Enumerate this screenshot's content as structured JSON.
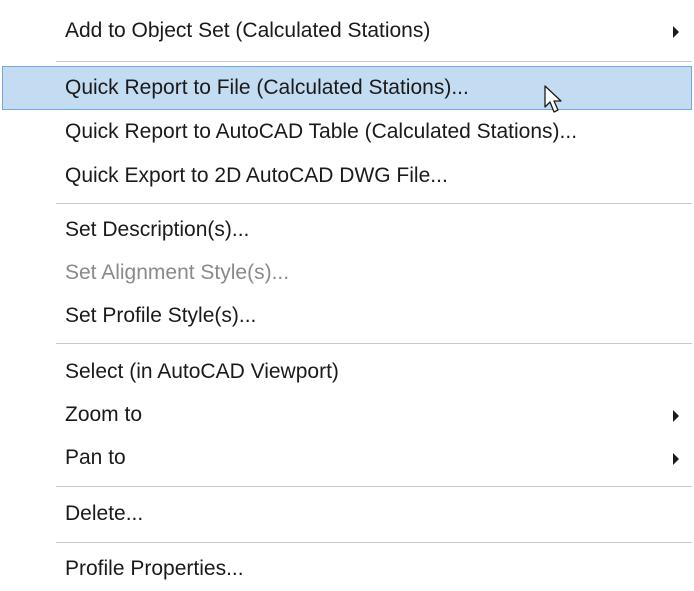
{
  "context_menu": {
    "items": [
      {
        "label": "Add to Object Set (Calculated Stations)",
        "submenu": true,
        "state": "normal"
      },
      {
        "label": "Quick Report to File (Calculated Stations)...",
        "submenu": false,
        "state": "highlighted"
      },
      {
        "label": "Quick Report to AutoCAD Table (Calculated Stations)...",
        "submenu": false,
        "state": "normal"
      },
      {
        "label": "Quick Export to 2D AutoCAD DWG File...",
        "submenu": false,
        "state": "normal"
      },
      {
        "label": "Set Description(s)...",
        "submenu": false,
        "state": "normal"
      },
      {
        "label": "Set Alignment Style(s)...",
        "submenu": false,
        "state": "disabled"
      },
      {
        "label": "Set Profile Style(s)...",
        "submenu": false,
        "state": "normal"
      },
      {
        "label": "Select (in AutoCAD Viewport)",
        "submenu": false,
        "state": "normal"
      },
      {
        "label": "Zoom to",
        "submenu": true,
        "state": "normal"
      },
      {
        "label": "Pan to",
        "submenu": true,
        "state": "normal"
      },
      {
        "label": "Delete...",
        "submenu": false,
        "state": "normal"
      },
      {
        "label": "Profile Properties...",
        "submenu": false,
        "state": "normal"
      }
    ],
    "submenu_icon": "chevron-right-icon",
    "pointer_icon": "mouse-pointer-icon",
    "colors": {
      "highlight_fill": "#c4dcf2",
      "highlight_border": "#6fa8dc",
      "text": "#1a1a1a",
      "disabled_text": "#8a8a8a",
      "separator": "#c8c8c8"
    }
  }
}
